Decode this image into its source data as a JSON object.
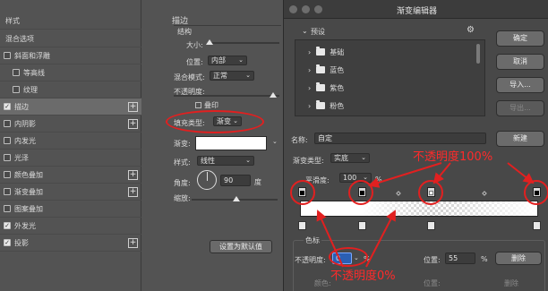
{
  "layer_styles": {
    "header": "样式",
    "blend_options": "混合选项",
    "items": [
      {
        "label": "斜面和浮雕",
        "checked": false
      },
      {
        "label": "等高线",
        "checked": false
      },
      {
        "label": "纹理",
        "checked": false
      },
      {
        "label": "描边",
        "checked": true,
        "selected": true
      },
      {
        "label": "内阴影",
        "checked": false
      },
      {
        "label": "内发光",
        "checked": false
      },
      {
        "label": "光泽",
        "checked": false
      },
      {
        "label": "颜色叠加",
        "checked": false
      },
      {
        "label": "渐变叠加",
        "checked": false
      },
      {
        "label": "图案叠加",
        "checked": false
      },
      {
        "label": "外发光",
        "checked": true
      },
      {
        "label": "投影",
        "checked": true
      }
    ],
    "plus": "+"
  },
  "stroke": {
    "title": "描边",
    "structure": "结构",
    "size_label": "大小:",
    "position_label": "位置:",
    "position_value": "内部",
    "blend_label": "混合模式:",
    "blend_value": "正常",
    "opacity_label": "不透明度:",
    "overprint": "叠印",
    "fill_type_label": "填充类型:",
    "fill_type_value": "渐变",
    "gradient_label": "渐变:",
    "style_label": "样式:",
    "style_value": "线性",
    "angle_label": "角度:",
    "angle_value": "90",
    "angle_unit": "度",
    "scale_label": "缩放:",
    "set_default": "设置为默认值"
  },
  "gradient_editor": {
    "title": "渐变编辑器",
    "presets_label": "预设",
    "presets": [
      "基础",
      "蓝色",
      "紫色",
      "粉色"
    ],
    "buttons": {
      "ok": "确定",
      "cancel": "取消",
      "import": "导入...",
      "export": "导出...",
      "new": "新建"
    },
    "name_label": "名称:",
    "name_value": "自定",
    "type_label": "渐变类型:",
    "type_value": "实底",
    "smoothness_label": "平滑度:",
    "smoothness_value": "100",
    "percent": "%",
    "stops_label": "色标",
    "opacity_label": "不透明度:",
    "opacity_value": "0",
    "location_label": "位置:",
    "location_value": "55",
    "delete": "删除",
    "color_label": "颜色:",
    "gear": "⚙"
  },
  "annotations": {
    "top": "不透明度100%",
    "bottom": "不透明度0%"
  },
  "colors": {
    "annotation_red": "#e12020"
  }
}
